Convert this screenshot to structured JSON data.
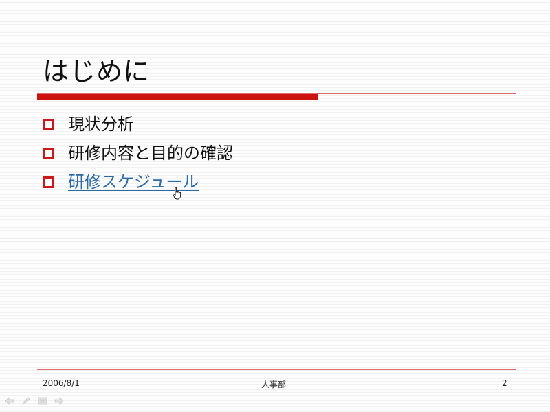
{
  "slide": {
    "title": "はじめに",
    "bullets": [
      {
        "text": "現状分析",
        "is_link": false
      },
      {
        "text": "研修内容と目的の確認",
        "is_link": false
      },
      {
        "text": "研修スケジュール",
        "is_link": true
      }
    ],
    "footer": {
      "date": "2006/8/1",
      "center": "人事部",
      "page": "2"
    }
  },
  "colors": {
    "accent": "#cc1111",
    "link": "#2c6aa5",
    "text": "#111111"
  },
  "icons": {
    "cursor": "hand-pointer-icon",
    "nav": [
      "previous-arrow-icon",
      "pen-icon",
      "menu-icon",
      "next-arrow-icon"
    ]
  }
}
